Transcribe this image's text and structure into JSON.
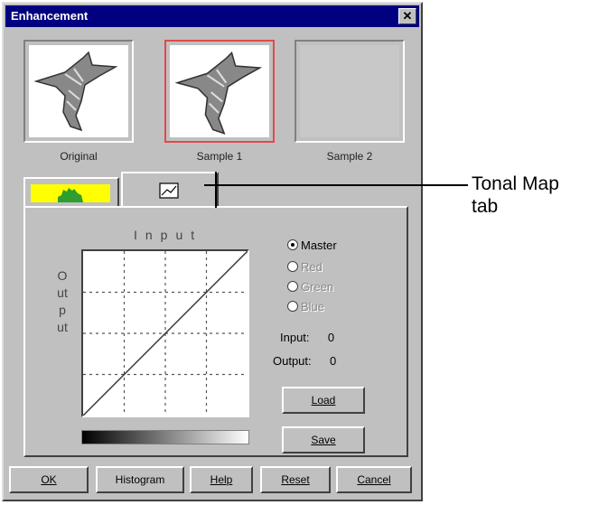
{
  "window": {
    "title": "Enhancement",
    "close_glyph": "✕"
  },
  "thumbnails": [
    {
      "label": "Original"
    },
    {
      "label": "Sample 1"
    },
    {
      "label": "Sample 2"
    }
  ],
  "tabs": [
    {
      "icon": "histogram-icon",
      "active": false
    },
    {
      "icon": "tonal-map-icon",
      "active": true
    }
  ],
  "graph": {
    "input_axis": "Input",
    "output_axis": "Output"
  },
  "channels": [
    {
      "label": "Master",
      "selected": true,
      "enabled": true
    },
    {
      "label": "Red",
      "selected": false,
      "enabled": false
    },
    {
      "label": "Green",
      "selected": false,
      "enabled": false
    },
    {
      "label": "Blue",
      "selected": false,
      "enabled": false
    }
  ],
  "readouts": {
    "input_label": "Input:",
    "input_value": "0",
    "output_label": "Output:",
    "output_value": "0"
  },
  "side_buttons": {
    "load": "Load",
    "save": "Save"
  },
  "bottom_buttons": {
    "ok": "OK",
    "histogram": "Histogram",
    "help": "Help",
    "reset": "Reset",
    "cancel": "Cancel"
  },
  "callout": {
    "line1": "Tonal Map",
    "line2": "tab"
  },
  "colors": {
    "titlebar": "#000080",
    "face": "#c0c0c0",
    "selected_border": "#e04a4a",
    "histogram_tab_bg": "#ffff00",
    "histogram_fill": "#2e9e2e"
  }
}
